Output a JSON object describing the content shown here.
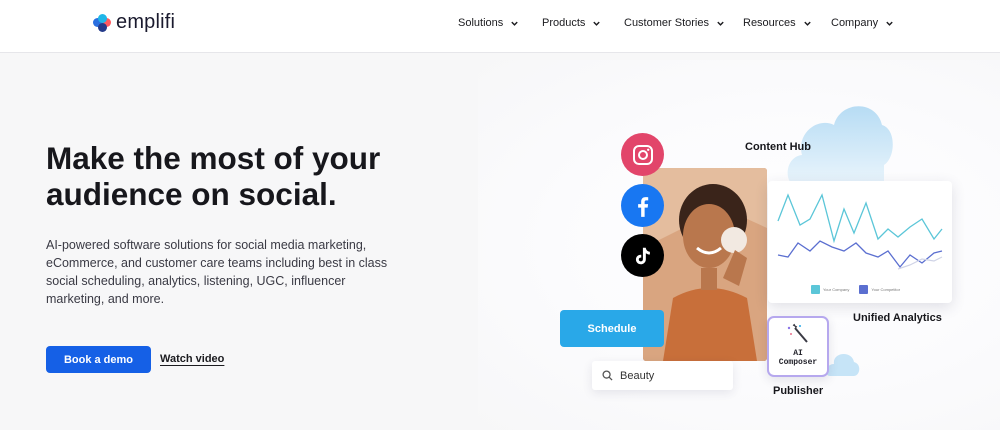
{
  "brand": {
    "name": "emplifi"
  },
  "nav": {
    "items": [
      {
        "label": "Solutions"
      },
      {
        "label": "Products"
      },
      {
        "label": "Customer Stories"
      },
      {
        "label": "Resources"
      },
      {
        "label": "Company"
      }
    ]
  },
  "hero": {
    "title_line1": "Make the most of your",
    "title_line2": "audience on social.",
    "description": "AI-powered software solutions for social media marketing, eCommerce, and customer care teams including best in class social scheduling, analytics, listening, UGC, influencer marketing, and more.",
    "primary_cta": "Book a demo",
    "secondary_cta": "Watch video"
  },
  "visual": {
    "content_hub_label": "Content Hub",
    "unified_analytics_label": "Unified Analytics",
    "publisher_label": "Publisher",
    "schedule_button": "Schedule",
    "search_value": "Beauty",
    "ai_composer_line1": "AI",
    "ai_composer_line2": "Composer",
    "legend": {
      "series1": "Your Company",
      "series2": "Your Competitor"
    },
    "social_icons": [
      "instagram-icon",
      "facebook-icon",
      "tiktok-icon"
    ]
  },
  "colors": {
    "primary": "#1560e6",
    "schedule": "#29a8e8",
    "instagram": "#e2456a",
    "facebook": "#1877f2",
    "series1": "#5bc6d8",
    "series2": "#5b6fd0"
  }
}
